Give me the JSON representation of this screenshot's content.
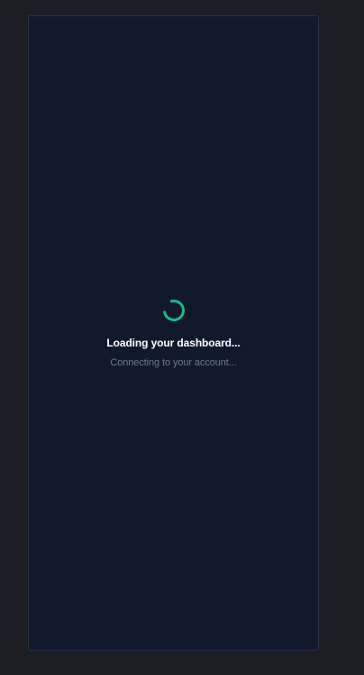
{
  "loading": {
    "title": "Loading your dashboard...",
    "subtitle": "Connecting to your account...",
    "spinner_icon": "spinner-icon"
  },
  "colors": {
    "page_background": "#1c1e24",
    "panel_background": "#111a2b",
    "panel_border": "#2a3140",
    "accent": "#1fb888",
    "title_text": "#ffffff",
    "subtitle_text": "#6e7a8e"
  }
}
